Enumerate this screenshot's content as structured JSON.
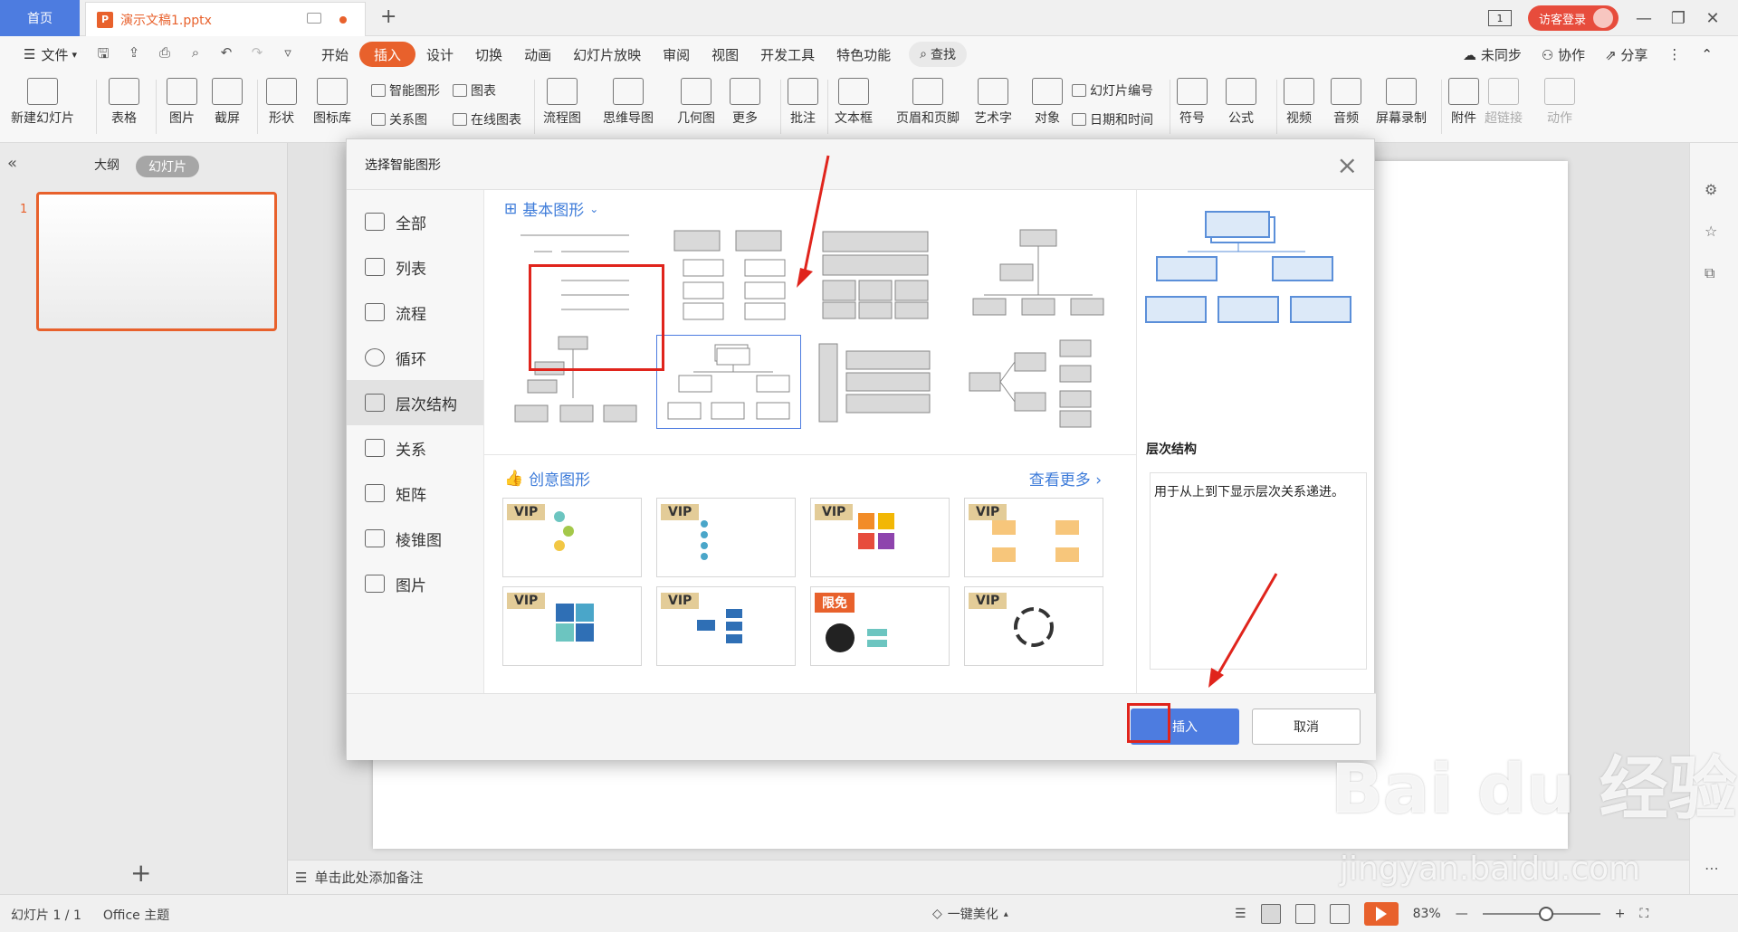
{
  "titlebar": {
    "home_tab": "首页",
    "doc_icon": "P",
    "doc_tab": "演示文稿1.pptx",
    "new_tab": "+",
    "slide_count_icon": "1",
    "visitor_login": "访客登录"
  },
  "menubar": {
    "file": "文件",
    "tabs": [
      "开始",
      "插入",
      "设计",
      "切换",
      "动画",
      "幻灯片放映",
      "审阅",
      "视图",
      "开发工具",
      "特色功能"
    ],
    "active_tab": "插入",
    "search": "查找",
    "unsync": "未同步",
    "collab": "协作",
    "share": "分享"
  },
  "ribbon": {
    "new_slide": "新建幻灯片",
    "table": "表格",
    "picture": "图片",
    "screenshot": "截屏",
    "shape": "形状",
    "icon_lib": "图标库",
    "smart_art": "智能图形",
    "chart": "图表",
    "relation": "关系图",
    "online_chart": "在线图表",
    "flowchart": "流程图",
    "mindmap": "思维导图",
    "geometry": "几何图",
    "more": "更多",
    "comment": "批注",
    "textbox": "文本框",
    "header_footer": "页眉和页脚",
    "wordart": "艺术字",
    "object": "对象",
    "slide_number": "幻灯片编号",
    "datetime": "日期和时间",
    "symbol": "符号",
    "formula": "公式",
    "video": "视频",
    "audio": "音频",
    "screen_record": "屏幕录制",
    "attachment": "附件",
    "hyperlink": "超链接",
    "action": "动作"
  },
  "leftpane": {
    "outline_tab": "大纲",
    "slides_tab": "幻灯片",
    "slide_number": "1",
    "add": "+"
  },
  "notes": {
    "placeholder": "单击此处添加备注"
  },
  "statusbar": {
    "slide_info": "幻灯片 1 / 1",
    "theme": "Office 主题",
    "beautify": "一键美化",
    "zoom": "83%"
  },
  "dialog": {
    "title": "选择智能图形",
    "close": "×",
    "categories": [
      "全部",
      "列表",
      "流程",
      "循环",
      "层次结构",
      "关系",
      "矩阵",
      "棱锥图",
      "图片"
    ],
    "active_category": "层次结构",
    "section_basic": "基本图形",
    "section_creative": "创意图形",
    "see_more": "查看更多",
    "vip_tags": [
      "VIP",
      "VIP",
      "VIP",
      "VIP",
      "VIP",
      "VIP",
      "限免",
      "VIP"
    ],
    "preview_title": "层次结构",
    "preview_desc": "用于从上到下显示层次关系递进。",
    "insert": "插入",
    "cancel": "取消"
  },
  "watermark": {
    "main": "Bai du 经验",
    "sub": "jingyan.baidu.com"
  },
  "colors": {
    "accent": "#e8612c",
    "primary_blue": "#4d7ce0",
    "highlight_red": "#e0241c"
  }
}
